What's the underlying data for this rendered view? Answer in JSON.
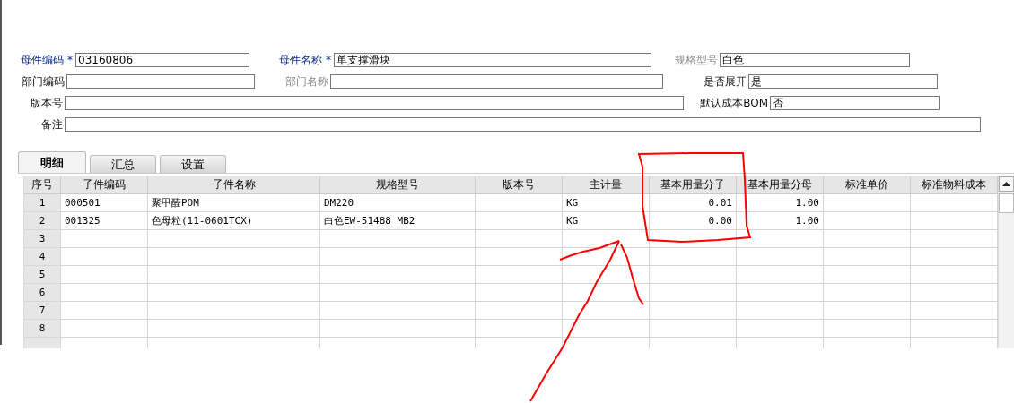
{
  "form": {
    "fields": [
      {
        "label": "母件编码",
        "kind": "required",
        "marker": "*",
        "value": "03160806"
      },
      {
        "label": "母件名称",
        "kind": "required",
        "marker": "*",
        "value": "单支撑滑块"
      },
      {
        "label": "规格型号",
        "kind": "muted",
        "value": "白色"
      },
      {
        "label": "部门编码",
        "kind": "plain"
      },
      {
        "label": "部门名称",
        "kind": "muted"
      },
      {
        "label": "是否展开",
        "kind": "plain",
        "value": "是"
      },
      {
        "label": "版本号",
        "kind": "plain"
      },
      {
        "label": "默认成本BOM",
        "kind": "plain",
        "value": "否"
      },
      {
        "label": "备注",
        "kind": "plain"
      }
    ]
  },
  "tabs": [
    {
      "label": "明细",
      "selected": true
    },
    {
      "label": "汇总",
      "selected": false
    },
    {
      "label": "设置",
      "selected": false
    }
  ],
  "table": {
    "columns": [
      {
        "label": "序号",
        "kind": "index"
      },
      {
        "label": "子件编码",
        "kind": "text"
      },
      {
        "label": "子件名称",
        "kind": "text"
      },
      {
        "label": "规格型号",
        "kind": "text"
      },
      {
        "label": "版本号",
        "kind": "text"
      },
      {
        "label": "主计量",
        "kind": "text"
      },
      {
        "label": "基本用量分子",
        "kind": "number"
      },
      {
        "label": "基本用量分母",
        "kind": "number"
      },
      {
        "label": "标准单价",
        "kind": "number"
      },
      {
        "label": "标准物料成本",
        "kind": "number"
      }
    ],
    "rows": [
      [
        "1",
        "000501",
        "聚甲醛POM",
        "DM220",
        "",
        "KG",
        "0.01",
        "1.00",
        "",
        ""
      ],
      [
        "2",
        "001325",
        "色母粒(11-0601TCX)",
        "白色EW-51488 MB2",
        "",
        "KG",
        "0.00",
        "1.00",
        "",
        ""
      ],
      [
        "3",
        "",
        "",
        "",
        "",
        "",
        "",
        "",
        "",
        ""
      ],
      [
        "4",
        "",
        "",
        "",
        "",
        "",
        "",
        "",
        "",
        ""
      ],
      [
        "5",
        "",
        "",
        "",
        "",
        "",
        "",
        "",
        "",
        ""
      ],
      [
        "6",
        "",
        "",
        "",
        "",
        "",
        "",
        "",
        "",
        ""
      ],
      [
        "7",
        "",
        "",
        "",
        "",
        "",
        "",
        "",
        "",
        ""
      ],
      [
        "8",
        "",
        "",
        "",
        "",
        "",
        "",
        "",
        "",
        ""
      ]
    ]
  }
}
